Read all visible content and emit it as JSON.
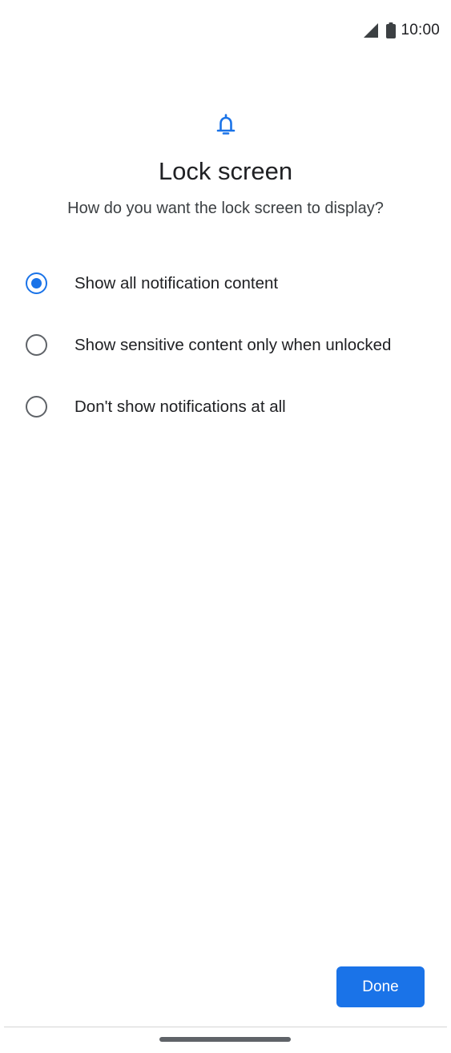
{
  "status_bar": {
    "time": "10:00",
    "icons": [
      "cellular-signal-icon",
      "battery-icon"
    ]
  },
  "header": {
    "icon": "bell-icon",
    "title": "Lock screen",
    "subtitle": "How do you want the lock screen to display?"
  },
  "options": [
    {
      "label": "Show all notification content",
      "selected": true
    },
    {
      "label": "Show sensitive content only when unlocked",
      "selected": false
    },
    {
      "label": "Don't show notifications at all",
      "selected": false
    }
  ],
  "footer": {
    "done_label": "Done"
  },
  "colors": {
    "accent": "#1a73e8",
    "text_primary": "#202124",
    "text_secondary": "#3c4043",
    "radio_unchecked": "#5f6368",
    "background": "#ffffff"
  }
}
